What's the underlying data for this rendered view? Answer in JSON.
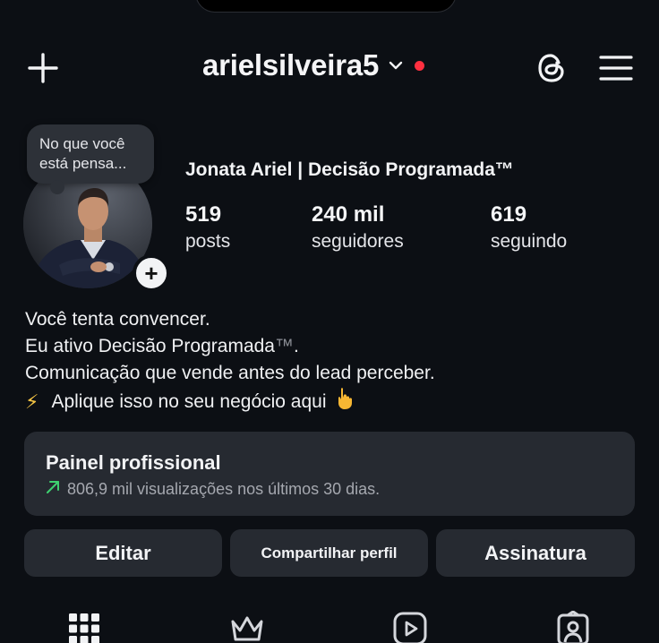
{
  "header": {
    "username": "arielsilveira5"
  },
  "note": {
    "text": "No que você está pensa..."
  },
  "profile": {
    "display_name": "Jonata Ariel | Decisão Programada™",
    "stats": [
      {
        "value": "519",
        "label": "posts"
      },
      {
        "value": "240 mil",
        "label": "seguidores"
      },
      {
        "value": "619",
        "label": "seguindo"
      }
    ]
  },
  "bio": {
    "line1": "Você tenta convencer.",
    "line2_prefix": "Eu ativo Decisão Programada",
    "line2_tm": "™",
    "line2_suffix": ".",
    "line3": "Comunicação que vende antes do lead perceber.",
    "line4": "Aplique isso no seu negócio aqui"
  },
  "panel": {
    "title": "Painel profissional",
    "subtitle": "806,9 mil visualizações nos últimos 30 dias."
  },
  "buttons": {
    "edit": "Editar",
    "share": "Compartilhar perfil",
    "subscription": "Assinatura"
  },
  "icons": {
    "new_post": "plus-icon",
    "account_switch": "chevron-down-icon",
    "threads": "threads-icon",
    "menu": "hamburger-icon",
    "grid_tab": "grid-icon",
    "subscriber_tab": "crown-icon",
    "reels_tab": "reels-icon",
    "tagged_tab": "tagged-icon"
  },
  "colors": {
    "background": "#0c0f14",
    "surface": "#262a31",
    "notification_dot": "#ff3040",
    "trend_up": "#3ed170"
  }
}
